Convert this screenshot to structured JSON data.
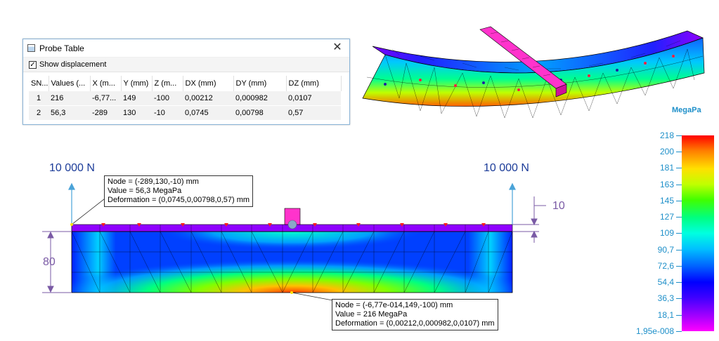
{
  "probe_table": {
    "title": "Probe Table",
    "show_displacement_label": "Show displacement",
    "show_displacement_checked": true,
    "close_glyph": "✕",
    "columns": [
      "SN...",
      "Values (...",
      "X (m...",
      "Y (mm)",
      "Z (m...",
      "DX (mm)",
      "DY (mm)",
      "DZ (mm)"
    ],
    "rows": [
      {
        "sn": "1",
        "value": "216",
        "x": "-6,77...",
        "y": "149",
        "z": "-100",
        "dx": "0,00212",
        "dy": "0,000982",
        "dz": "0,0107"
      },
      {
        "sn": "2",
        "value": "56,3",
        "x": "-289",
        "y": "130",
        "z": "-10",
        "dx": "0,0745",
        "dy": "0,00798",
        "dz": "0,57"
      }
    ]
  },
  "legend": {
    "unit": "MegaPa",
    "labels": [
      "218",
      "200",
      "181",
      "163",
      "145",
      "127",
      "109",
      "90,7",
      "72,6",
      "54,4",
      "36,3",
      "18,1",
      "1,95e-008"
    ]
  },
  "loads": {
    "left": "10 000 N",
    "right": "10 000 N"
  },
  "dimensions": {
    "height": "80",
    "top": "10"
  },
  "annotations": {
    "probe2": {
      "node": "Node = (-289,130,-10) mm",
      "value": "Value = 56,3 MegaPa",
      "deformation": "Deformation = (0,0745,0,00798,0,57) mm"
    },
    "probe1": {
      "node": "Node = (-6,77e-014,149,-100) mm",
      "value": "Value = 216 MegaPa",
      "deformation": "Deformation = (0,00212,0,000982,0,0107) mm"
    }
  },
  "colors": {
    "accent": "#1d8fc9",
    "load_arrow": "#4aa3d8",
    "dimension": "#7a5aa5",
    "punch": "#ff33cc"
  }
}
